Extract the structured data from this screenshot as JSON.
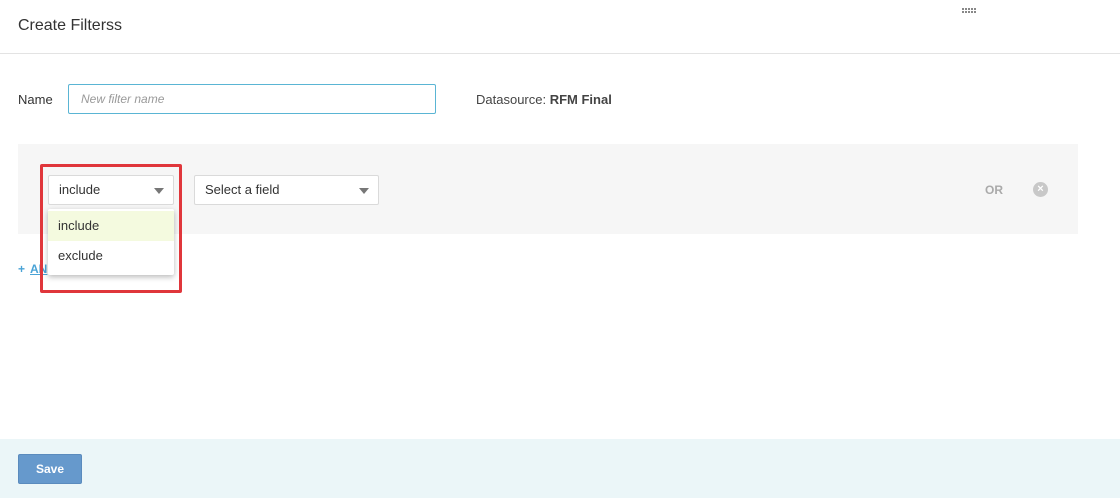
{
  "header": {
    "title": "Create Filterss"
  },
  "form": {
    "name_label": "Name",
    "name_value": "",
    "name_placeholder": "New filter name",
    "datasource_label": "Datasource:",
    "datasource_value": "RFM Final"
  },
  "filter": {
    "mode_selected": "include",
    "field_selected": "Select a field",
    "or_label": "OR",
    "remove_icon": "×",
    "mode_options": [
      "include",
      "exclude"
    ]
  },
  "add_link": {
    "plus": "+",
    "label": "AN"
  },
  "footer": {
    "save_label": "Save"
  },
  "colors": {
    "accent_border": "#5ab5d4",
    "highlight": "#e0363b",
    "save_button": "#6699cc",
    "footer_bg": "#ebf6f8",
    "selected_option_bg": "#f4fadf"
  }
}
